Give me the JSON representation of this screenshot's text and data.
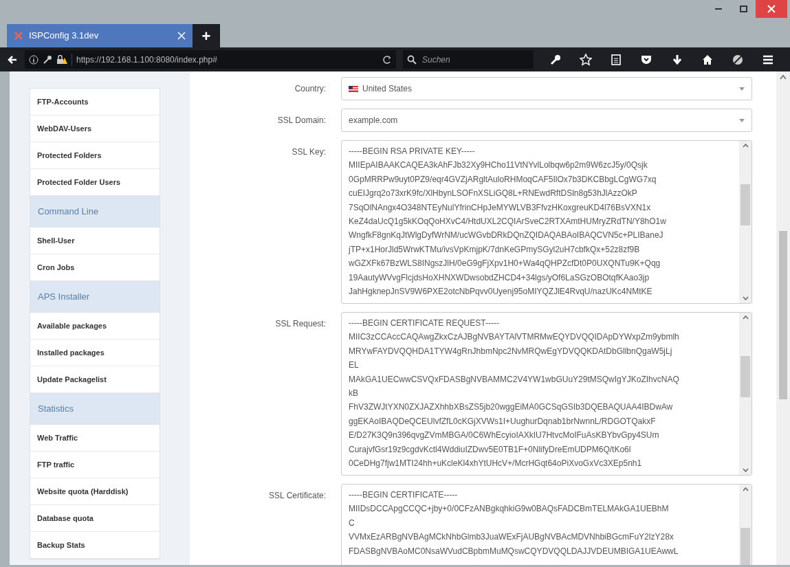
{
  "window": {
    "tab_title": "ISPConfig 3.1dev",
    "new_tab": "+",
    "url": "https://192.168.1.100:8080/index.php#",
    "search_placeholder": "Suchen"
  },
  "sidebar": [
    {
      "kind": "item",
      "label": "FTP-Accounts"
    },
    {
      "kind": "item",
      "label": "WebDAV-Users"
    },
    {
      "kind": "item",
      "label": "Protected Folders"
    },
    {
      "kind": "item",
      "label": "Protected Folder Users"
    },
    {
      "kind": "header",
      "label": "Command Line"
    },
    {
      "kind": "item",
      "label": "Shell-User"
    },
    {
      "kind": "item",
      "label": "Cron Jobs"
    },
    {
      "kind": "header",
      "label": "APS Installer"
    },
    {
      "kind": "item",
      "label": "Available packages"
    },
    {
      "kind": "item",
      "label": "Installed packages"
    },
    {
      "kind": "item",
      "label": "Update Packagelist"
    },
    {
      "kind": "header",
      "label": "Statistics"
    },
    {
      "kind": "item",
      "label": "Web Traffic"
    },
    {
      "kind": "item",
      "label": "FTP traffic"
    },
    {
      "kind": "item",
      "label": "Website quota (Harddisk)"
    },
    {
      "kind": "item",
      "label": "Database quota"
    },
    {
      "kind": "item",
      "label": "Backup Stats"
    }
  ],
  "form": [
    {
      "kind": "select",
      "label": "Country:",
      "value": "United States"
    },
    {
      "kind": "select",
      "label": "SSL Domain:",
      "value": "example.com"
    },
    {
      "kind": "textarea",
      "label": "SSL Key:",
      "lines": [
        "-----BEGIN RSA PRIVATE KEY-----",
        "MIIEpAIBAAKCAQEA3kAhFJb32Xy9HCho11VtNYvlLolbqw6p2m9W6zcJ5y/0Qsjk",
        "0GpMRRPw9uyt0PZ9/eqr4GVZjARgltAuloRHMoqCAF5IlOx7b3DKCBbgLCgWG7xq",
        "cuEIJgrq2o73xrK9fc/XlHbynLSOFnXSLiGQ8L+RNEwdRftDSln8g53hJlAzzOkP",
        "7SqOlNAngx4O348NTEyNulYfrinCHpJeMYWLVB3FfvzHKoxgreuKD4l76BsVXN1x",
        "KeZ4daUcQ1g5kKOqQoHXvC4/HtdUXL2CQIArSveC2RTXAmtHUMryZRdTN/Y8hO1w",
        "WngfkF8gnKqJtWlgDyfWrNM/ucWGvbDRkDQnZQIDAQABAoIBAQCVN5c+PLIBaneJ",
        "jTP+x1HorJld5WrwKTMu/ivsVpKmjpK/7dnKeGPmySGyl2uH7cbfkQx+52z8zf9B",
        "wGZXFk67BzWLS8INgszJlH/0eG9gFjXpv1H0+Wa4qQHPZcfDt0P0UXQNTu9K+Qqg",
        "19AautyWVvgFlcjdsHoXHNXWDwsobdZHCD4+34lgs/yOf6LaSGzOBOtqfKAao3jp",
        "JahHgknepJnSV9W6PXE2otcNbPqvv0Uyenj95oMIYQZJlE4RvqU/nazUKc4NMtKE"
      ]
    },
    {
      "kind": "textarea",
      "label": "SSL Request:",
      "lines": [
        "-----BEGIN CERTIFICATE REQUEST-----",
        "MIIC3zCCAccCAQAwgZkxCzAJBgNVBAYTAlVTMRMwEQYDVQQIDApDYWxpZm9ybmlh",
        "MRYwFAYDVQQHDA1TYW4gRnJhbmNpc2NvMRQwEgYDVQQKDAtDbGllbnQgaW5jLj",
        "EL",
        "MAkGA1UECwwCSVQxFDASBgNVBAMMC2V4YW1wbGUuY29tMSQwIgYJKoZIhvcNAQ",
        "kB",
        "FhV3ZWJtYXN0ZXJAZXhhbXBsZS5jb20wggEiMA0GCSqGSIb3DQEBAQUAA4IBDwAw",
        "ggEKAoIBAQDeQCEUlvfZfL0cKGjXVWs1I+UughurDqnab1brNwnnL/RDGOTQakxF",
        "E/D27K3Q9n396qvgZVmMBGA/0C6WhEcyioIAXkIU7HtvcMoIFuAsKBYbvGpy4SUm",
        "CurajvfGsr19z9cgdvKctl4WddiuIZDwv5E0TB1F+0NlifyDreEmUDPM6Q/tKo6l",
        "0CeDHg7fjw1MTI24hh+uKcleKl4xhYtUHcV+/McrHGqt64oPiXvoGxVc3XEp5nh1"
      ]
    },
    {
      "kind": "textarea",
      "label": "SSL Certificate:",
      "lines": [
        "-----BEGIN CERTIFICATE-----",
        "MIIDsDCCApgCCQC+jby+0/0CFzANBgkqhkiG9w0BAQsFADCBmTELMAkGA1UEBhM",
        "C",
        "VVMxEzARBgNVBAgMCkNhbGlmb3JuaWExFjAUBgNVBAcMDVNhbiBGcmFuY2lzY28x",
        "FDASBgNVBAoMC0NsaWVudCBpbmMuMQswCQYDVQQLDAJJVDEUMBIGA1UEAwwL"
      ]
    }
  ]
}
